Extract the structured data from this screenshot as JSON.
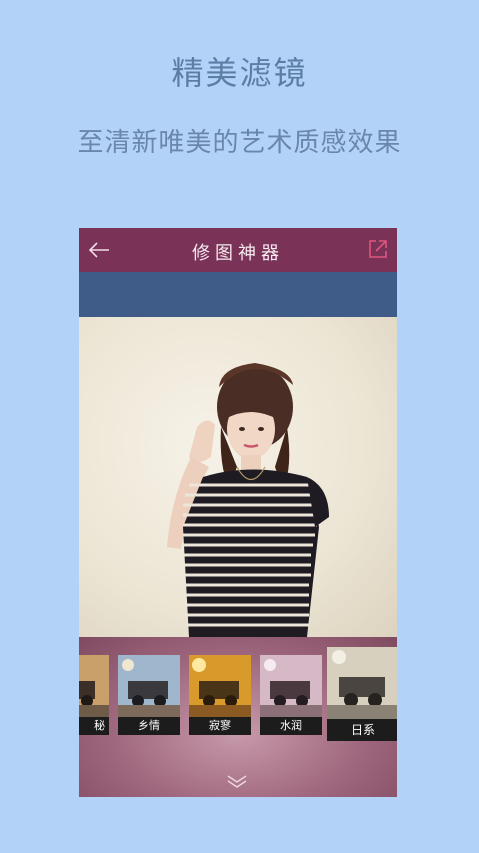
{
  "promo": {
    "title": "精美滤镜",
    "subtitle": "至清新唯美的艺术质感效果"
  },
  "app": {
    "title": "修图神器",
    "back_icon": "arrow-left-icon",
    "share_icon": "share-icon"
  },
  "filters": [
    {
      "label": "神秘",
      "tint": "#c9a06a"
    },
    {
      "label": "乡情",
      "tint": "#7a9ab8"
    },
    {
      "label": "寂寥",
      "tint": "#d89a2a"
    },
    {
      "label": "水润",
      "tint": "#c7a7b8"
    },
    {
      "label": "日系",
      "tint": "#d8d0bf"
    }
  ],
  "visible_filter_labels": {
    "f0": "秘",
    "f1": "乡情",
    "f2": "寂寥",
    "f3": "水润",
    "f4": "日系"
  },
  "selected_filter": "日系",
  "colors": {
    "background": "#b2d3f7",
    "topbar": "#7a3257",
    "bluebar": "#3e5c87",
    "accent": "#e0567e"
  }
}
